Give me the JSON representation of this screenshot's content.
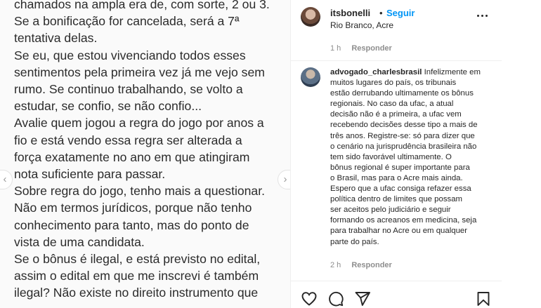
{
  "post": {
    "text_lines": [
      "chamados na ampla era de, com sorte, 2 ou 3.",
      "Se a bonificação for cancelada, será a 7ª",
      "tentativa delas.",
      "Se eu, que estou vivenciando todos esses",
      "sentimentos pela primeira vez já me vejo sem",
      "rumo. Se continuo trabalhando, se volto a",
      "estudar, se confio, se não confio...",
      "Avalie quem jogou a regra do jogo por anos a",
      "fio e está vendo essa regra ser alterada a",
      "força exatamente no ano em que atingiram",
      "nota suficiente para passar.",
      "Sobre regra do jogo, tenho mais a questionar.",
      "Não em termos jurídicos, porque não tenho",
      "conhecimento para tanto, mas do ponto de",
      "vista de uma candidata.",
      "Se o bônus é ilegal, e está previsto no edital,",
      "assim o edital em que me inscrevi é também",
      "ilegal? Não existe no direito instrumento que"
    ],
    "prev_arrow": "‹",
    "next_arrow": "›"
  },
  "header": {
    "username": "itsbonelli",
    "separator": "•",
    "follow_label": "Seguir",
    "location": "Rio Branco, Acre",
    "more_icon": "more-options-icon"
  },
  "caption_meta": {
    "time": "1 h",
    "reply_label": "Responder"
  },
  "comment": {
    "username": "advogado_charlesbrasil",
    "first_line_text": "Infelizmente em",
    "lines": [
      "muitos lugares do país, os tribunais",
      "estão derrubando ultimamente os bônus",
      "regionais. No caso da ufac, a atual",
      "decisão não é a primeira, a ufac vem",
      "recebendo decisões desse tipo a mais de",
      "três anos. Registre-se: só para dizer que",
      "o cenário na jurisprudência brasileira não",
      "tem sido favorável ultimamente. O",
      "bônus regional é super importante para",
      "o Brasil, mas para o Acre mais ainda.",
      "Espero que a ufac consiga refazer essa",
      "política dentro de limites que possam",
      "ser aceitos pelo judiciário e seguir",
      "formando os acreanos em medicina, seja",
      "para trabalhar no Acre ou em qualquer",
      "parte do país."
    ],
    "time": "2 h",
    "reply_label": "Responder"
  },
  "actions": {
    "icons": [
      "heart-icon",
      "comment-icon",
      "share-icon",
      "save-icon"
    ]
  }
}
